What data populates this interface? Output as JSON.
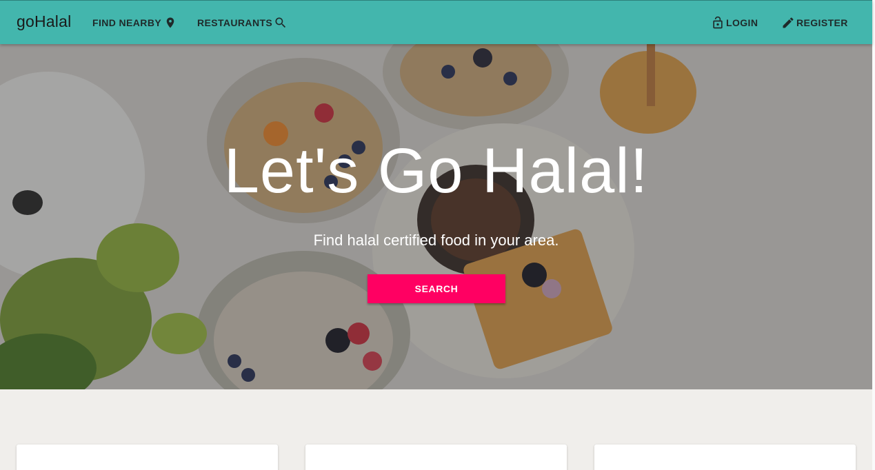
{
  "navbar": {
    "brand": "goHalal",
    "find_nearby": {
      "label": "FIND NEARBY",
      "icon": "location-pin-icon"
    },
    "restaurants": {
      "label": "RESTAURANTS",
      "icon": "search-icon"
    },
    "login": {
      "label": "LOGIN",
      "icon": "lock-icon"
    },
    "register": {
      "label": "REGISTER",
      "icon": "pencil-icon"
    }
  },
  "hero": {
    "title": "Let's Go Halal!",
    "subtitle": "Find halal certified food in your area.",
    "search_label": "SEARCH"
  },
  "colors": {
    "navbar": "#43b6ad",
    "accent": "#ff0062",
    "background": "#f0eeeb"
  }
}
